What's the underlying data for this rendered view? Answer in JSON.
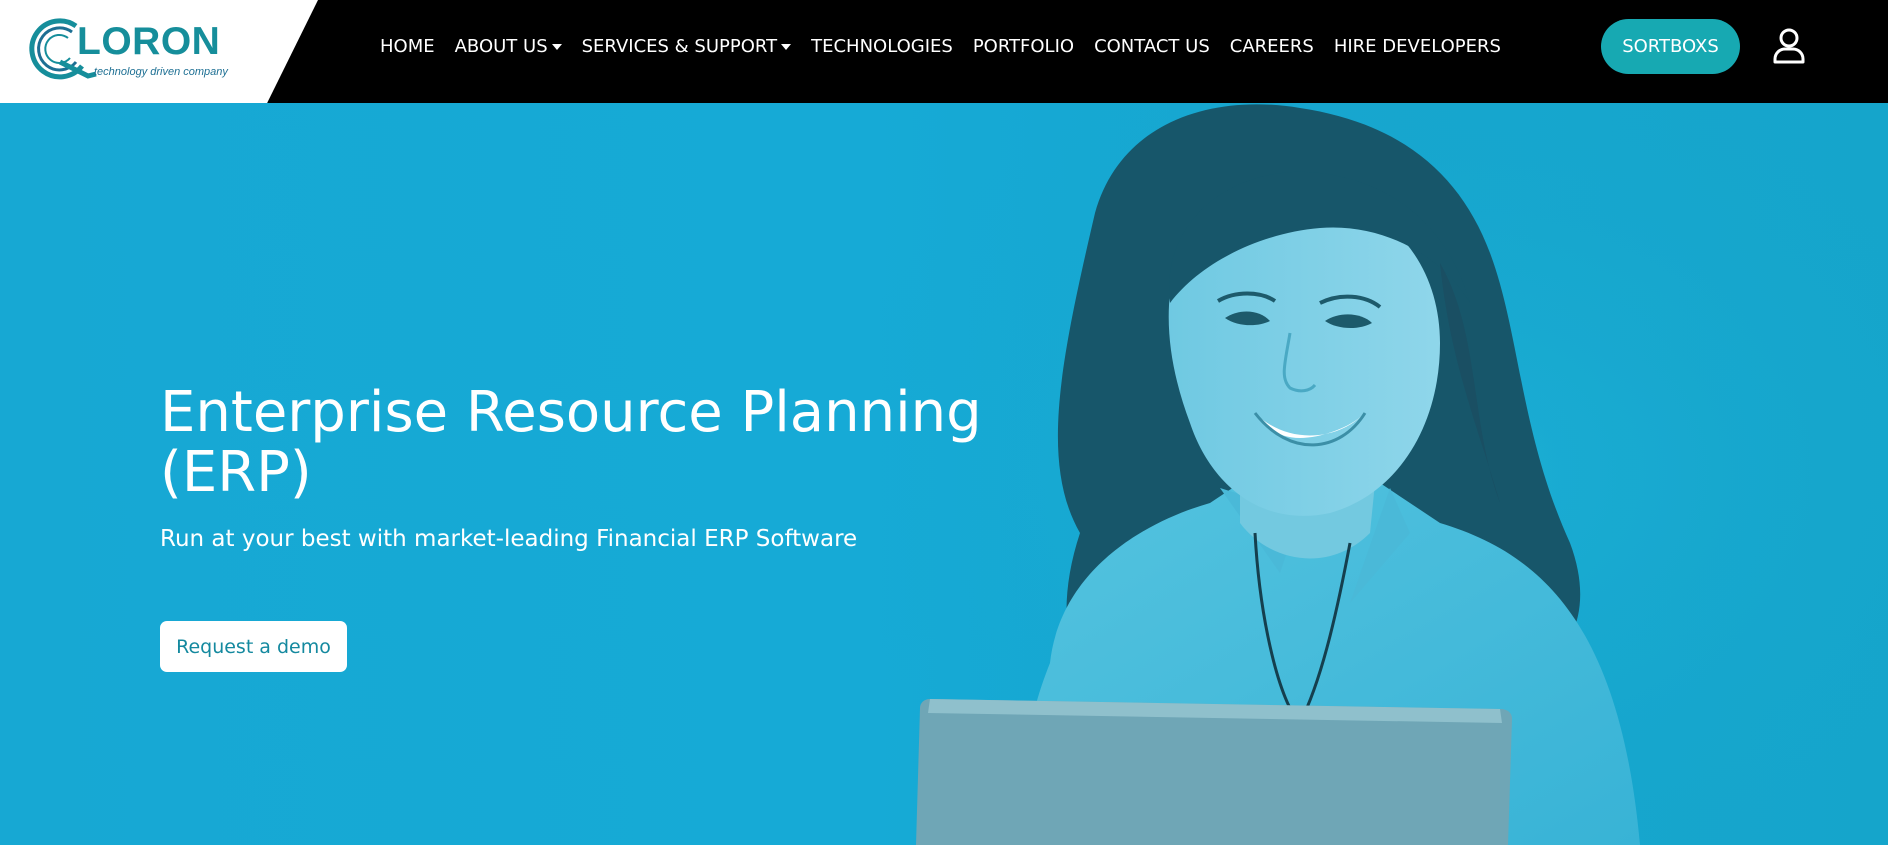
{
  "brand": {
    "name": "LORON",
    "tagline": "technology driven company",
    "accent_color": "#17a9b2",
    "logo_color": "#168e9b"
  },
  "nav": {
    "items": [
      {
        "label": "HOME",
        "dropdown": false
      },
      {
        "label": "ABOUT US",
        "dropdown": true
      },
      {
        "label": "SERVICES & SUPPORT",
        "dropdown": true
      },
      {
        "label": "TECHNOLOGIES",
        "dropdown": false
      },
      {
        "label": "PORTFOLIO",
        "dropdown": false
      },
      {
        "label": "CONTACT US",
        "dropdown": false
      },
      {
        "label": "CAREERS",
        "dropdown": false
      },
      {
        "label": "HIRE DEVELOPERS",
        "dropdown": false
      }
    ],
    "cta_label": "SORTBOXS",
    "user_icon": "user-icon"
  },
  "hero": {
    "title": "Enterprise Resource Planning (ERP)",
    "subtitle": "Run at your best with market-leading Financial ERP Software",
    "button_label": "Request a demo",
    "background_color": "#15a7cf",
    "image": "smiling-woman-with-laptop"
  }
}
